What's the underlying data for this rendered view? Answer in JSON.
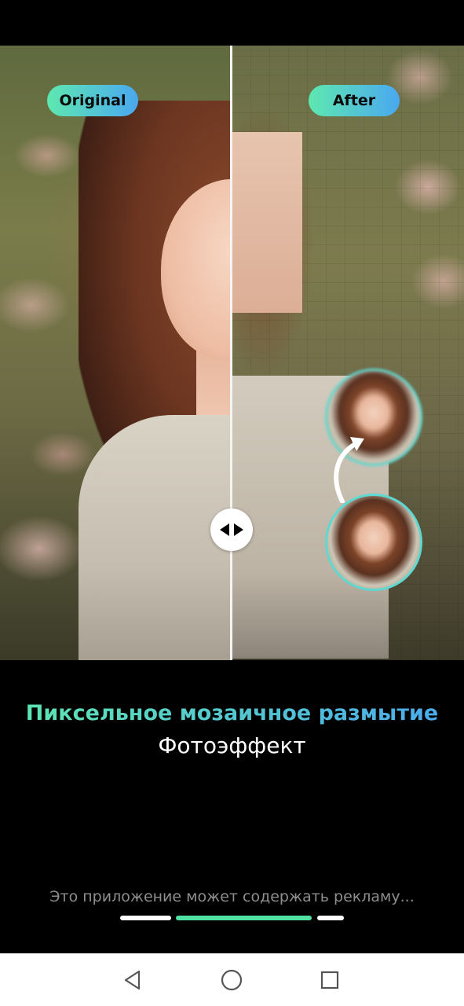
{
  "compare": {
    "label_original": "Original",
    "label_after": "After",
    "handle_icon": "left-right-arrows-icon",
    "accent_gradient": [
      "#5ee8b0",
      "#4aa8f0"
    ]
  },
  "promo": {
    "title": "Пиксельное мозаичное размытие",
    "subtitle": "Фотоэффект"
  },
  "footer": {
    "ad_notice": "Это приложение может содержать рекламу...",
    "pager_active_index": 1,
    "pager_count": 3,
    "pager_active_color": "#4fe0a4"
  },
  "navbar": {
    "back_icon": "back-triangle-icon",
    "home_icon": "home-circle-icon",
    "recent_icon": "recent-square-icon"
  }
}
